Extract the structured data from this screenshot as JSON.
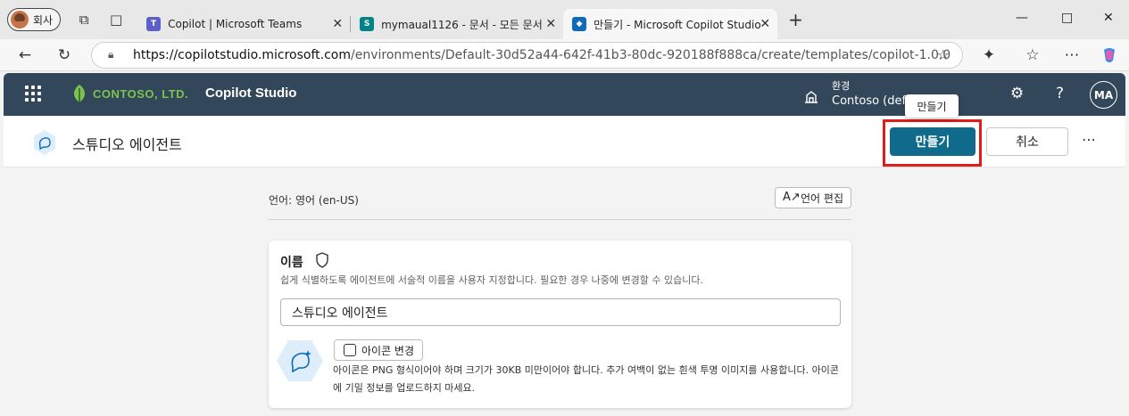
{
  "browser": {
    "profile_label": "회사",
    "tabs": [
      {
        "title": "Copilot | Microsoft Teams",
        "favicon": "teams-icon",
        "color": "#5b5fc7"
      },
      {
        "title": "mymaual1126 - 문서 - 모든 문서",
        "favicon": "sharepoint-icon",
        "color": "#038387"
      },
      {
        "title": "만들기 - Microsoft Copilot Studio",
        "favicon": "copilot-studio-icon",
        "color": "#0f6cbd"
      }
    ],
    "url_host": "https://copilotstudio.microsoft.com",
    "url_path": "/environments/Default-30d52a44-642f-41b3-80dc-920188f888ca/create/templates/copilot-1.0.0"
  },
  "app": {
    "company": "CONTOSO, LTD.",
    "name": "Copilot Studio",
    "env_label": "환경",
    "env_value": "Contoso (default)",
    "avatar_initials": "MA",
    "header_color": "#33475b",
    "accent_color": "#0f6a8b",
    "logo_color": "#7cc24e"
  },
  "toolbar": {
    "title": "스튜디오 에이전트",
    "create_label": "만들기",
    "cancel_label": "취소",
    "tooltip": "만들기",
    "highlight_color": "#e31b1b"
  },
  "main": {
    "language_text": "언어: 영어 (en-US)",
    "edit_language_label": "언어 편집",
    "name_label": "이름",
    "name_desc": "쉽게 식별하도록 에이전트에 서술적 이름을 사용자 지정합니다. 필요한 경우 나중에 변경할 수 있습니다.",
    "name_value": "스튜디오 에이전트",
    "change_icon_label": "아이콘 변경",
    "icon_desc": "아이콘은 PNG 형식이어야 하며 크기가 30KB 미만이어야 합니다. 추가 여백이 없는 흰색 투명 이미지를 사용합니다. 아이콘에 기밀 정보를 업로드하지 마세요."
  }
}
